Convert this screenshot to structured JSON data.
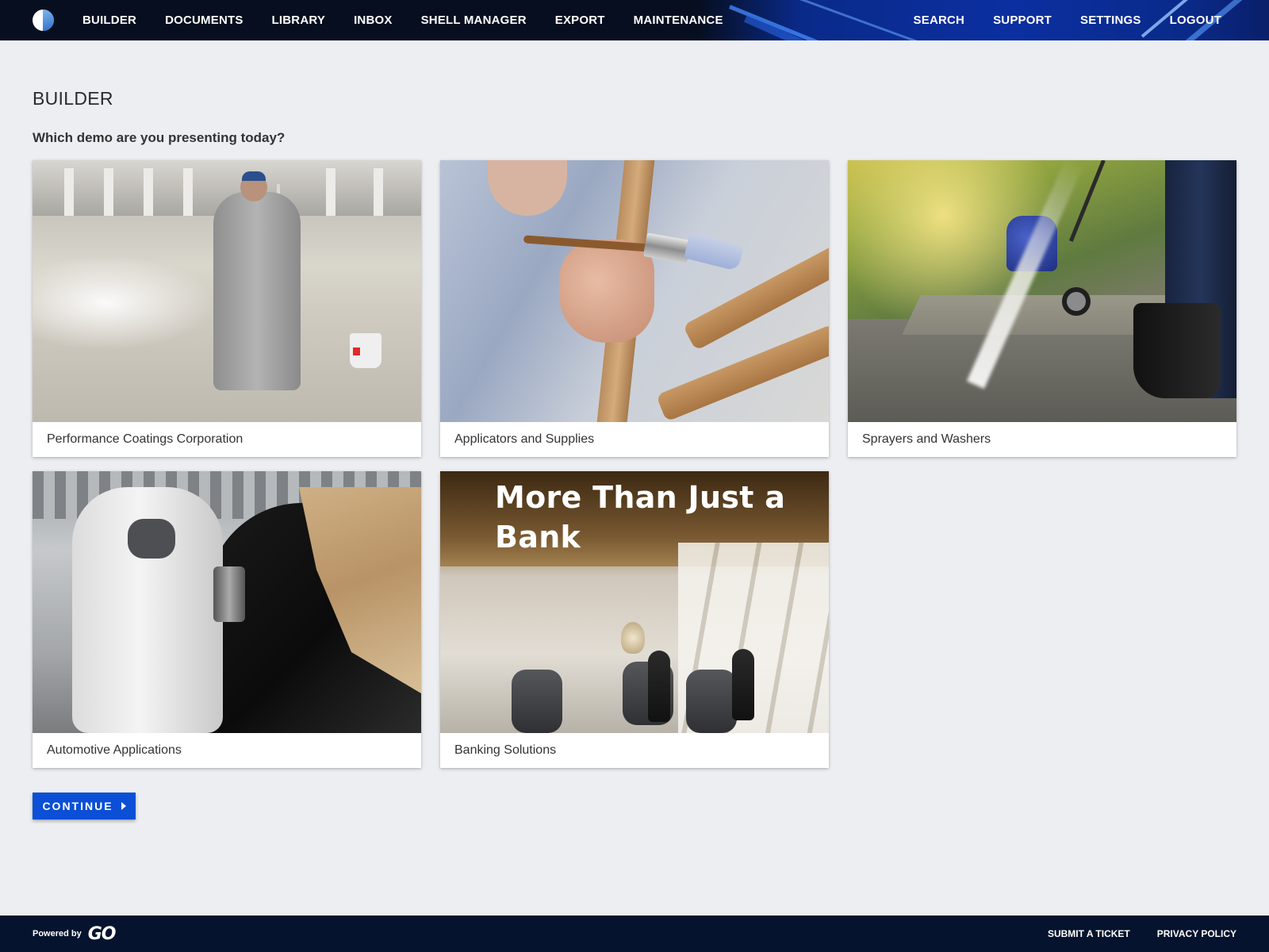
{
  "nav": {
    "logo_icon": "half-circle-logo-icon",
    "left": [
      {
        "label": "BUILDER"
      },
      {
        "label": "DOCUMENTS"
      },
      {
        "label": "LIBRARY"
      },
      {
        "label": "INBOX"
      },
      {
        "label": "SHELL MANAGER"
      },
      {
        "label": "EXPORT"
      },
      {
        "label": "MAINTENANCE"
      }
    ],
    "right": [
      {
        "label": "SEARCH"
      },
      {
        "label": "SUPPORT"
      },
      {
        "label": "SETTINGS"
      },
      {
        "label": "LOGOUT"
      }
    ]
  },
  "page": {
    "title": "BUILDER",
    "question": "Which demo are you presenting today?"
  },
  "demos": [
    {
      "label": "Performance Coatings Corporation"
    },
    {
      "label": "Applicators and Supplies"
    },
    {
      "label": "Sprayers and Washers"
    },
    {
      "label": "Automotive Applications"
    },
    {
      "label": "Banking Solutions",
      "image_text": "More Than Just a Bank"
    }
  ],
  "actions": {
    "continue_label": "CONTINUE",
    "continue_icon": "caret-right-icon"
  },
  "footer": {
    "powered_by": "Powered by",
    "brand": "GO",
    "links": [
      {
        "label": "SUBMIT A TICKET"
      },
      {
        "label": "PRIVACY POLICY"
      }
    ]
  },
  "colors": {
    "nav_bg": "#060e1f",
    "accent_blue": "#0b4fd6",
    "page_bg": "#eceef2",
    "footer_bg": "#06132e"
  }
}
